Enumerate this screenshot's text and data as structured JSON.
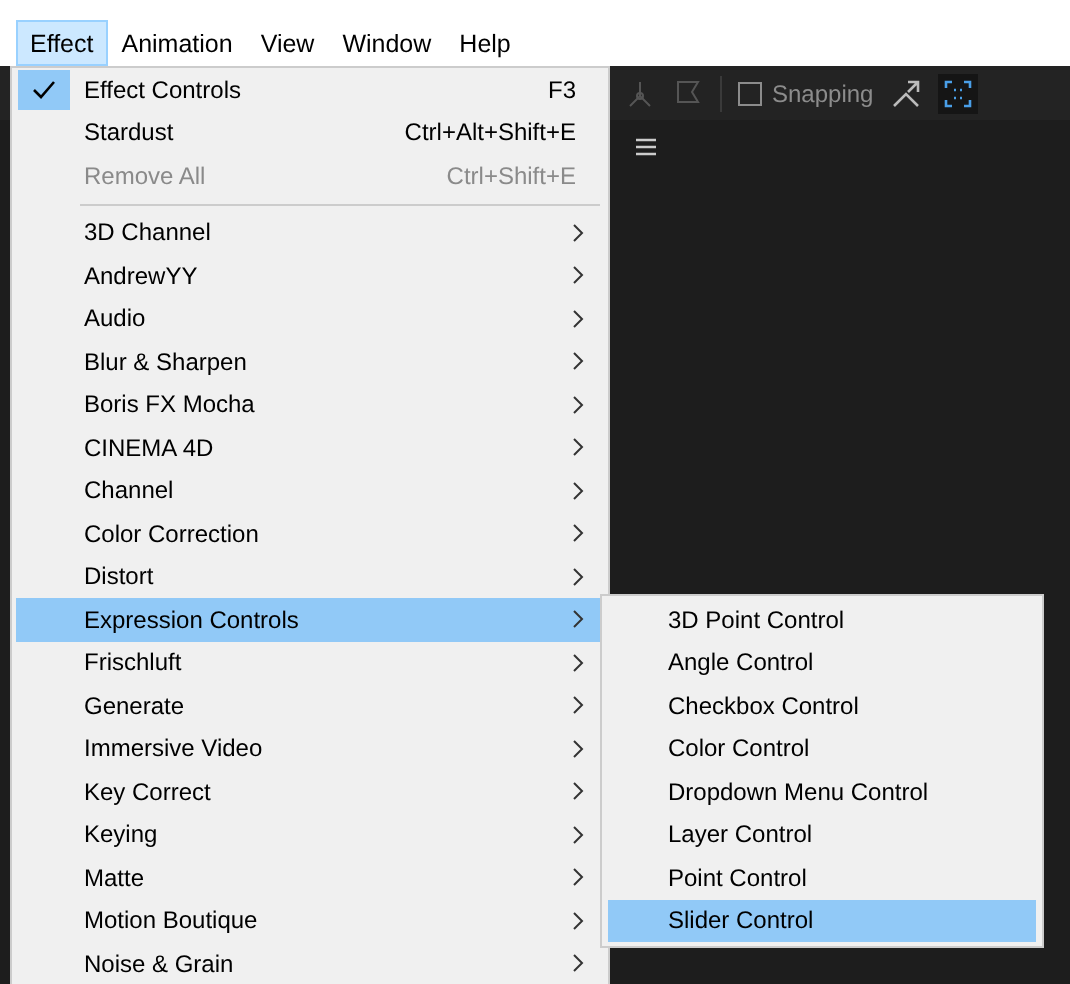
{
  "menu_bar": [
    {
      "label": "Effect",
      "selected": true
    },
    {
      "label": "Animation",
      "selected": false
    },
    {
      "label": "View",
      "selected": false
    },
    {
      "label": "Window",
      "selected": false
    },
    {
      "label": "Help",
      "selected": false
    }
  ],
  "toolbar": {
    "snapping": {
      "label": "Snapping",
      "checked": false
    }
  },
  "effect_menu": {
    "items": [
      {
        "kind": "command",
        "label": "Effect Controls",
        "shortcut": "F3",
        "checked": true,
        "disabled": false
      },
      {
        "kind": "command",
        "label": "Stardust",
        "shortcut": "Ctrl+Alt+Shift+E",
        "checked": false,
        "disabled": false
      },
      {
        "kind": "command",
        "label": "Remove All",
        "shortcut": "Ctrl+Shift+E",
        "checked": false,
        "disabled": true
      },
      {
        "kind": "separator"
      },
      {
        "kind": "submenu",
        "label": "3D Channel",
        "selected": false
      },
      {
        "kind": "submenu",
        "label": "AndrewYY",
        "selected": false
      },
      {
        "kind": "submenu",
        "label": "Audio",
        "selected": false
      },
      {
        "kind": "submenu",
        "label": "Blur & Sharpen",
        "selected": false
      },
      {
        "kind": "submenu",
        "label": "Boris FX Mocha",
        "selected": false
      },
      {
        "kind": "submenu",
        "label": "CINEMA 4D",
        "selected": false
      },
      {
        "kind": "submenu",
        "label": "Channel",
        "selected": false
      },
      {
        "kind": "submenu",
        "label": "Color Correction",
        "selected": false
      },
      {
        "kind": "submenu",
        "label": "Distort",
        "selected": false
      },
      {
        "kind": "submenu",
        "label": "Expression Controls",
        "selected": true
      },
      {
        "kind": "submenu",
        "label": "Frischluft",
        "selected": false
      },
      {
        "kind": "submenu",
        "label": "Generate",
        "selected": false
      },
      {
        "kind": "submenu",
        "label": "Immersive Video",
        "selected": false
      },
      {
        "kind": "submenu",
        "label": "Key Correct",
        "selected": false
      },
      {
        "kind": "submenu",
        "label": "Keying",
        "selected": false
      },
      {
        "kind": "submenu",
        "label": "Matte",
        "selected": false
      },
      {
        "kind": "submenu",
        "label": "Motion Boutique",
        "selected": false
      },
      {
        "kind": "submenu",
        "label": "Noise & Grain",
        "selected": false
      }
    ]
  },
  "expression_controls_submenu": {
    "items": [
      {
        "label": "3D Point Control",
        "selected": false
      },
      {
        "label": "Angle Control",
        "selected": false
      },
      {
        "label": "Checkbox Control",
        "selected": false
      },
      {
        "label": "Color Control",
        "selected": false
      },
      {
        "label": "Dropdown Menu Control",
        "selected": false
      },
      {
        "label": "Layer Control",
        "selected": false
      },
      {
        "label": "Point Control",
        "selected": false
      },
      {
        "label": "Slider Control",
        "selected": true
      }
    ]
  }
}
